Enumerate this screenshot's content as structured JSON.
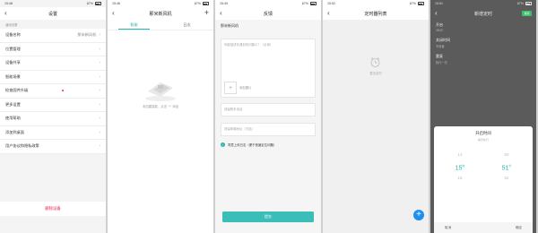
{
  "screens": [
    {
      "status": {
        "time": "15:48",
        "battery": "87%"
      },
      "title": "设置",
      "section": "通用设置",
      "items": [
        {
          "label": "设备名称",
          "value": "那米新风机"
        },
        {
          "label": "位置管理",
          "value": ""
        },
        {
          "label": "设备共享",
          "value": ""
        },
        {
          "label": "智能场景",
          "value": ""
        },
        {
          "label": "检查固件升级",
          "value": ""
        },
        {
          "label": "更多设置",
          "value": ""
        },
        {
          "label": "使用帮助",
          "value": ""
        },
        {
          "label": "添加到桌面",
          "value": ""
        },
        {
          "label": "用户协议和隐私政策",
          "value": ""
        }
      ],
      "delete_label": "删除设备"
    },
    {
      "status": {
        "time": "15:46",
        "battery": "87%"
      },
      "title": "那米新风机",
      "tabs": [
        "智能",
        "日志"
      ],
      "empty_text": "未创建智能，点击 \"+\" 添加"
    },
    {
      "status": {
        "time": "15:49",
        "battery": "87%"
      },
      "title": "反馈",
      "label": "那米新风机",
      "desc_placeholder": "你能描述你遇到的问题么？（必填）",
      "add_image": "添加图片",
      "phone_placeholder": "请留联系电话",
      "email_placeholder": "请留邮箱地址（可选）",
      "log_label": "同意上传日志（便于快速定位问题）",
      "submit_label": "提交"
    },
    {
      "status": {
        "time": "15:52",
        "battery": "87%"
      },
      "title": "定时器列表",
      "empty_text": "暂无定时"
    },
    {
      "status": {
        "time": "15:51",
        "battery": "87%"
      },
      "title": "新增定时",
      "save_label": "保存",
      "fields": [
        {
          "title": "开启",
          "value": "08:00"
        },
        {
          "title": "关闭时间",
          "value": "不设置"
        },
        {
          "title": "重复",
          "value": "执行一次"
        }
      ],
      "sheet_title": "开启时间",
      "sheet_sub": "每天执行",
      "hours": [
        "14",
        "15",
        "16"
      ],
      "minutes": [
        "50",
        "51",
        "52"
      ],
      "hour_unit": "时",
      "minute_unit": "分",
      "cancel": "取消",
      "confirm": "确定"
    }
  ]
}
